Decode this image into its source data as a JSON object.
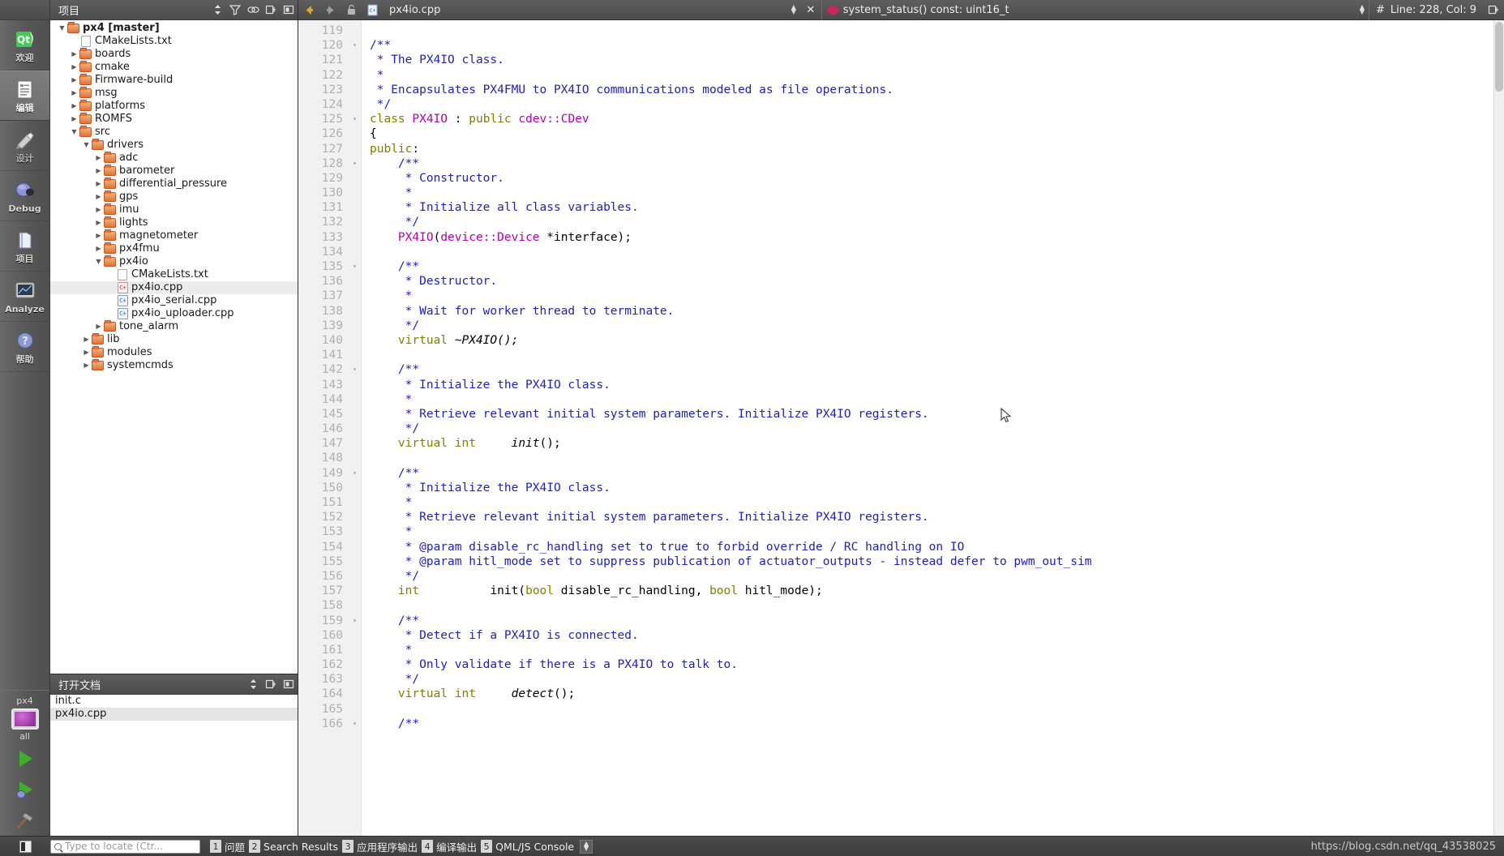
{
  "modebar": {
    "items": [
      {
        "label": "欢迎",
        "icon": "qt-logo-icon",
        "active": false
      },
      {
        "label": "编辑",
        "icon": "edit-document-icon",
        "active": true
      },
      {
        "label": "设计",
        "icon": "design-brush-icon",
        "active": false
      },
      {
        "label": "Debug",
        "icon": "debug-bug-icon",
        "active": false
      },
      {
        "label": "项目",
        "icon": "projects-folder-icon",
        "active": false
      },
      {
        "label": "Analyze",
        "icon": "analyze-graph-icon",
        "active": false
      },
      {
        "label": "帮助",
        "icon": "help-question-icon",
        "active": false
      }
    ],
    "kit": {
      "name": "px4",
      "sub": "all"
    },
    "run_button": "run-icon",
    "debug_button": "debug-run-icon",
    "build_button": "build-hammer-icon"
  },
  "project_dock": {
    "title": "项目",
    "header_buttons": [
      "sort-spin-icon",
      "filter-icon",
      "link-icon",
      "split-icon",
      "close-dock-icon"
    ],
    "tree": [
      {
        "depth": 0,
        "arrow": "open",
        "icon": "folder",
        "label": "px4 [master]",
        "bold": true,
        "sel": false
      },
      {
        "depth": 1,
        "arrow": "none",
        "icon": "file",
        "label": "CMakeLists.txt",
        "bold": false,
        "sel": false
      },
      {
        "depth": 1,
        "arrow": "closed",
        "icon": "folder",
        "label": "boards",
        "bold": false,
        "sel": false
      },
      {
        "depth": 1,
        "arrow": "closed",
        "icon": "folder",
        "label": "cmake",
        "bold": false,
        "sel": false
      },
      {
        "depth": 1,
        "arrow": "closed",
        "icon": "folder",
        "label": "Firmware-build",
        "bold": false,
        "sel": false
      },
      {
        "depth": 1,
        "arrow": "closed",
        "icon": "folder",
        "label": "msg",
        "bold": false,
        "sel": false
      },
      {
        "depth": 1,
        "arrow": "closed",
        "icon": "folder",
        "label": "platforms",
        "bold": false,
        "sel": false
      },
      {
        "depth": 1,
        "arrow": "closed",
        "icon": "folder",
        "label": "ROMFS",
        "bold": false,
        "sel": false
      },
      {
        "depth": 1,
        "arrow": "open",
        "icon": "folder",
        "label": "src",
        "bold": false,
        "sel": false
      },
      {
        "depth": 2,
        "arrow": "open",
        "icon": "folder",
        "label": "drivers",
        "bold": false,
        "sel": false
      },
      {
        "depth": 3,
        "arrow": "closed",
        "icon": "folder",
        "label": "adc",
        "bold": false,
        "sel": false
      },
      {
        "depth": 3,
        "arrow": "closed",
        "icon": "folder",
        "label": "barometer",
        "bold": false,
        "sel": false
      },
      {
        "depth": 3,
        "arrow": "closed",
        "icon": "folder",
        "label": "differential_pressure",
        "bold": false,
        "sel": false
      },
      {
        "depth": 3,
        "arrow": "closed",
        "icon": "folder",
        "label": "gps",
        "bold": false,
        "sel": false
      },
      {
        "depth": 3,
        "arrow": "closed",
        "icon": "folder",
        "label": "imu",
        "bold": false,
        "sel": false
      },
      {
        "depth": 3,
        "arrow": "closed",
        "icon": "folder",
        "label": "lights",
        "bold": false,
        "sel": false
      },
      {
        "depth": 3,
        "arrow": "closed",
        "icon": "folder",
        "label": "magnetometer",
        "bold": false,
        "sel": false
      },
      {
        "depth": 3,
        "arrow": "closed",
        "icon": "folder",
        "label": "px4fmu",
        "bold": false,
        "sel": false
      },
      {
        "depth": 3,
        "arrow": "open",
        "icon": "folder",
        "label": "px4io",
        "bold": false,
        "sel": false
      },
      {
        "depth": 4,
        "arrow": "none",
        "icon": "file",
        "label": "CMakeLists.txt",
        "bold": false,
        "sel": false
      },
      {
        "depth": 4,
        "arrow": "none",
        "icon": "cpp-sel",
        "label": "px4io.cpp",
        "bold": false,
        "sel": true
      },
      {
        "depth": 4,
        "arrow": "none",
        "icon": "cpp",
        "label": "px4io_serial.cpp",
        "bold": false,
        "sel": false
      },
      {
        "depth": 4,
        "arrow": "none",
        "icon": "cpp",
        "label": "px4io_uploader.cpp",
        "bold": false,
        "sel": false
      },
      {
        "depth": 3,
        "arrow": "closed",
        "icon": "folder",
        "label": "tone_alarm",
        "bold": false,
        "sel": false
      },
      {
        "depth": 2,
        "arrow": "closed",
        "icon": "folder",
        "label": "lib",
        "bold": false,
        "sel": false
      },
      {
        "depth": 2,
        "arrow": "closed",
        "icon": "folder",
        "label": "modules",
        "bold": false,
        "sel": false
      },
      {
        "depth": 2,
        "arrow": "closed",
        "icon": "folder",
        "label": "systemcmds",
        "bold": false,
        "sel": false
      }
    ]
  },
  "open_documents": {
    "title": "打开文档",
    "header_buttons": [
      "sort-spin-icon",
      "split-icon",
      "close-dock-icon"
    ],
    "items": [
      {
        "label": "init.c",
        "sel": false
      },
      {
        "label": "px4io.cpp",
        "sel": true
      }
    ]
  },
  "editor_bar": {
    "back_icon": "back-arrow-icon",
    "forward_icon": "forward-arrow-icon",
    "lock_icon": "unlocked-icon",
    "file_icon": "cpp-file-icon",
    "filename": "px4io.cpp",
    "close_label": "✕",
    "symbol_icon": "symbol-method-icon",
    "symbol": "system_status() const: uint16_t",
    "line_col_icon": "#",
    "line_col": "Line: 228, Col: 9",
    "split_icon": "split-editor-icon"
  },
  "editor": {
    "first_line": 119,
    "lines": [
      {
        "n": 119,
        "fold": "",
        "frags": []
      },
      {
        "n": 120,
        "fold": "▾",
        "frags": [
          {
            "t": "/**",
            "c": "cm"
          }
        ]
      },
      {
        "n": 121,
        "fold": "",
        "frags": [
          {
            "t": " * The PX4IO class.",
            "c": "cm"
          }
        ]
      },
      {
        "n": 122,
        "fold": "",
        "frags": [
          {
            "t": " *",
            "c": "cm"
          }
        ]
      },
      {
        "n": 123,
        "fold": "",
        "frags": [
          {
            "t": " * Encapsulates PX4FMU to PX4IO communications modeled as file operations.",
            "c": "cm"
          }
        ]
      },
      {
        "n": 124,
        "fold": "",
        "frags": [
          {
            "t": " */",
            "c": "cm"
          }
        ]
      },
      {
        "n": 125,
        "fold": "▾",
        "frags": [
          {
            "t": "class ",
            "c": "kw"
          },
          {
            "t": "PX4IO",
            "c": "ty"
          },
          {
            "t": " : ",
            "c": ""
          },
          {
            "t": "public ",
            "c": "kw"
          },
          {
            "t": "cdev::CDev",
            "c": "ty"
          }
        ]
      },
      {
        "n": 126,
        "fold": "",
        "frags": [
          {
            "t": "{",
            "c": ""
          }
        ]
      },
      {
        "n": 127,
        "fold": "",
        "frags": [
          {
            "t": "public",
            "c": "kw"
          },
          {
            "t": ":",
            "c": ""
          }
        ]
      },
      {
        "n": 128,
        "fold": "▾",
        "frags": [
          {
            "t": "    /**",
            "c": "cm"
          }
        ]
      },
      {
        "n": 129,
        "fold": "",
        "frags": [
          {
            "t": "     * Constructor.",
            "c": "cm"
          }
        ]
      },
      {
        "n": 130,
        "fold": "",
        "frags": [
          {
            "t": "     *",
            "c": "cm"
          }
        ]
      },
      {
        "n": 131,
        "fold": "",
        "frags": [
          {
            "t": "     * Initialize all class variables.",
            "c": "cm"
          }
        ]
      },
      {
        "n": 132,
        "fold": "",
        "frags": [
          {
            "t": "     */",
            "c": "cm"
          }
        ]
      },
      {
        "n": 133,
        "fold": "",
        "frags": [
          {
            "t": "    ",
            "c": ""
          },
          {
            "t": "PX4IO",
            "c": "ty"
          },
          {
            "t": "(",
            "c": ""
          },
          {
            "t": "device::Device",
            "c": "ty"
          },
          {
            "t": " *interface);",
            "c": ""
          }
        ]
      },
      {
        "n": 134,
        "fold": "",
        "frags": []
      },
      {
        "n": 135,
        "fold": "▾",
        "frags": [
          {
            "t": "    /**",
            "c": "cm"
          }
        ]
      },
      {
        "n": 136,
        "fold": "",
        "frags": [
          {
            "t": "     * Destructor.",
            "c": "cm"
          }
        ]
      },
      {
        "n": 137,
        "fold": "",
        "frags": [
          {
            "t": "     *",
            "c": "cm"
          }
        ]
      },
      {
        "n": 138,
        "fold": "",
        "frags": [
          {
            "t": "     * Wait for worker thread to terminate.",
            "c": "cm"
          }
        ]
      },
      {
        "n": 139,
        "fold": "",
        "frags": [
          {
            "t": "     */",
            "c": "cm"
          }
        ]
      },
      {
        "n": 140,
        "fold": "",
        "frags": [
          {
            "t": "    ",
            "c": ""
          },
          {
            "t": "virtual ",
            "c": "kw"
          },
          {
            "t": "~PX4IO();",
            "c": "it"
          }
        ]
      },
      {
        "n": 141,
        "fold": "",
        "frags": []
      },
      {
        "n": 142,
        "fold": "▾",
        "frags": [
          {
            "t": "    /**",
            "c": "cm"
          }
        ]
      },
      {
        "n": 143,
        "fold": "",
        "frags": [
          {
            "t": "     * Initialize the PX4IO class.",
            "c": "cm"
          }
        ]
      },
      {
        "n": 144,
        "fold": "",
        "frags": [
          {
            "t": "     *",
            "c": "cm"
          }
        ]
      },
      {
        "n": 145,
        "fold": "",
        "frags": [
          {
            "t": "     * Retrieve relevant initial system parameters. Initialize PX4IO registers.",
            "c": "cm"
          }
        ]
      },
      {
        "n": 146,
        "fold": "",
        "frags": [
          {
            "t": "     */",
            "c": "cm"
          }
        ]
      },
      {
        "n": 147,
        "fold": "",
        "frags": [
          {
            "t": "    ",
            "c": ""
          },
          {
            "t": "virtual int",
            "c": "kw"
          },
          {
            "t": "     ",
            "c": ""
          },
          {
            "t": "init",
            "c": "it"
          },
          {
            "t": "();",
            "c": ""
          }
        ]
      },
      {
        "n": 148,
        "fold": "",
        "frags": []
      },
      {
        "n": 149,
        "fold": "▾",
        "frags": [
          {
            "t": "    /**",
            "c": "cm"
          }
        ]
      },
      {
        "n": 150,
        "fold": "",
        "frags": [
          {
            "t": "     * Initialize the PX4IO class.",
            "c": "cm"
          }
        ]
      },
      {
        "n": 151,
        "fold": "",
        "frags": [
          {
            "t": "     *",
            "c": "cm"
          }
        ]
      },
      {
        "n": 152,
        "fold": "",
        "frags": [
          {
            "t": "     * Retrieve relevant initial system parameters. Initialize PX4IO registers.",
            "c": "cm"
          }
        ]
      },
      {
        "n": 153,
        "fold": "",
        "frags": [
          {
            "t": "     *",
            "c": "cm"
          }
        ]
      },
      {
        "n": 154,
        "fold": "",
        "frags": [
          {
            "t": "     * @param disable_rc_handling set to true to forbid override / RC handling on IO",
            "c": "cm"
          }
        ]
      },
      {
        "n": 155,
        "fold": "",
        "frags": [
          {
            "t": "     * @param hitl_mode set to suppress publication of actuator_outputs - instead defer to pwm_out_sim",
            "c": "cm"
          }
        ]
      },
      {
        "n": 156,
        "fold": "",
        "frags": [
          {
            "t": "     */",
            "c": "cm"
          }
        ]
      },
      {
        "n": 157,
        "fold": "",
        "frags": [
          {
            "t": "    ",
            "c": ""
          },
          {
            "t": "int",
            "c": "kw"
          },
          {
            "t": "          ",
            "c": ""
          },
          {
            "t": "init",
            "c": ""
          },
          {
            "t": "(",
            "c": ""
          },
          {
            "t": "bool",
            "c": "kw"
          },
          {
            "t": " disable_rc_handling, ",
            "c": ""
          },
          {
            "t": "bool",
            "c": "kw"
          },
          {
            "t": " hitl_mode);",
            "c": ""
          }
        ]
      },
      {
        "n": 158,
        "fold": "",
        "frags": []
      },
      {
        "n": 159,
        "fold": "▾",
        "frags": [
          {
            "t": "    /**",
            "c": "cm"
          }
        ]
      },
      {
        "n": 160,
        "fold": "",
        "frags": [
          {
            "t": "     * Detect if a PX4IO is connected.",
            "c": "cm"
          }
        ]
      },
      {
        "n": 161,
        "fold": "",
        "frags": [
          {
            "t": "     *",
            "c": "cm"
          }
        ]
      },
      {
        "n": 162,
        "fold": "",
        "frags": [
          {
            "t": "     * Only validate if there is a PX4IO to talk to.",
            "c": "cm"
          }
        ]
      },
      {
        "n": 163,
        "fold": "",
        "frags": [
          {
            "t": "     */",
            "c": "cm"
          }
        ]
      },
      {
        "n": 164,
        "fold": "",
        "frags": [
          {
            "t": "    ",
            "c": ""
          },
          {
            "t": "virtual int",
            "c": "kw"
          },
          {
            "t": "     ",
            "c": ""
          },
          {
            "t": "detect",
            "c": "it"
          },
          {
            "t": "();",
            "c": ""
          }
        ]
      },
      {
        "n": 165,
        "fold": "",
        "frags": []
      },
      {
        "n": 166,
        "fold": "▾",
        "frags": [
          {
            "t": "    /**",
            "c": "cm"
          }
        ]
      }
    ]
  },
  "statusbar": {
    "hide_sidebar_icon": "hide-sidebar-icon",
    "locate_placeholder": "Type to locate (Ctr...",
    "search_icon": "search-icon",
    "panels": [
      {
        "num": "1",
        "label": "问题"
      },
      {
        "num": "2",
        "label": "Search Results"
      },
      {
        "num": "3",
        "label": "应用程序输出"
      },
      {
        "num": "4",
        "label": "编译输出"
      },
      {
        "num": "5",
        "label": "QML/JS Console"
      }
    ],
    "watermark": "https://blog.csdn.net/qq_43538025"
  },
  "colors": {
    "comment": "#2020c0",
    "keyword": "#808000",
    "type": "#b000b0",
    "gutter_bg": "#f1f1f1",
    "selection": "#ececec",
    "chrome": "#4f4f4f"
  }
}
